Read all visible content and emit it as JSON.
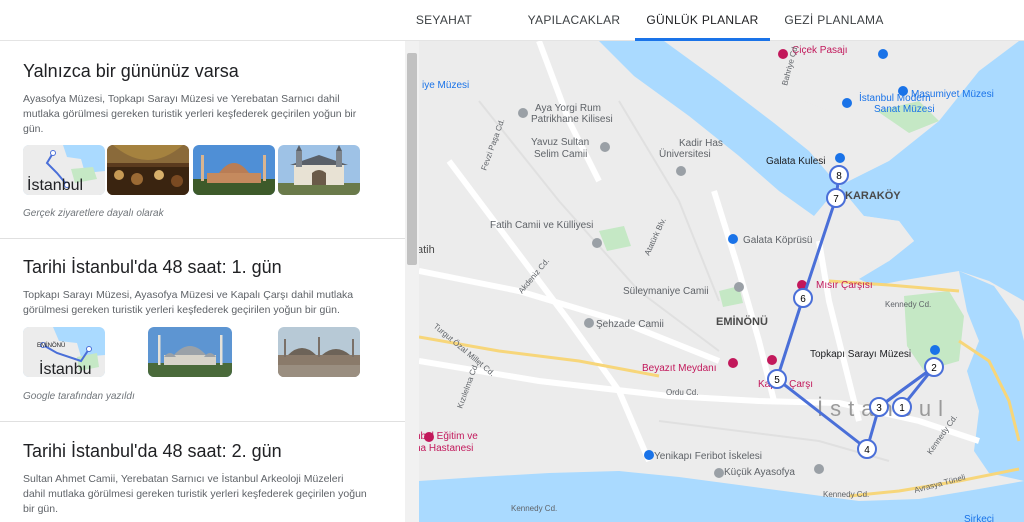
{
  "tabs": [
    {
      "label": "SEYAHAT REHBERİ"
    },
    {
      "label": "YAPILACAKLAR"
    },
    {
      "label": "GÜNLÜK PLANLAR",
      "active": true
    },
    {
      "label": "GEZİ PLANLAMA"
    }
  ],
  "plans": [
    {
      "title": "Yalnızca bir gününüz varsa",
      "description": "Ayasofya Müzesi, Topkapı Sarayı Müzesi ve Yerebatan Sarnıcı dahil mutlaka görülmesi gereken turistik yerleri keşfederek geçirilen yoğun bir gün.",
      "map_thumb_label": "İstanbul",
      "source": "Gerçek ziyaretlere dayalı olarak"
    },
    {
      "title": "Tarihi İstanbul'da 48 saat: 1. gün",
      "description": "Topkapı Sarayı Müzesi, Ayasofya Müzesi ve Kapalı Çarşı dahil mutlaka görülmesi gereken turistik yerleri keşfederek geçirilen yoğun bir gün.",
      "map_thumb_label": "İstanbu",
      "map_thumb_sublabel": "EMİNÖNÜ",
      "source": "Google tarafından yazıldı"
    },
    {
      "title": "Tarihi İstanbul'da 48 saat: 2. gün",
      "description": "Sultan Ahmet Camii, Yerebatan Sarnıcı ve İstanbul Arkeoloji Müzeleri dahil mutlaka görülmesi gereken turistik yerleri keşfederek geçirilen yoğun bir gün."
    }
  ],
  "map": {
    "city_label": "İstanbul",
    "labels": {
      "cicek_pasaji": "Çiçek Pasajı",
      "masumiyet": "Masumiyet Müzesi",
      "istanbul_modern": "İstanbul Modern",
      "sanat_muzesi": "Sanat Müzesi",
      "aya_yorgi": "Aya Yorgi Rum",
      "patrikhane": "Patrikhane Kilisesi",
      "kadir_has": "Kadir Has",
      "universitesi": "Üniversitesi",
      "yavuz_sultan": "Yavuz Sultan",
      "selim_camii": "Selim Camii",
      "galata_kulesi": "Galata Kulesi",
      "karakoy": "KARAKÖY",
      "fatih_camii": "Fatih Camii ve Külliyesi",
      "galata_koprusu": "Galata Köprüsü",
      "fatih": "atih",
      "misir_carsisi": "Mısır Çarşısı",
      "suleymaniye": "Süleymaniye Camii",
      "sehzade": "Şehzade Camii",
      "eminonu": "EMİNÖNÜ",
      "kennedy": "Kennedy Cd.",
      "topkapi": "Topkapı Sarayı Müzesi",
      "beyazit": "Beyazıt Meydanı",
      "kapali_carsi": "Kapalı Çarşı",
      "ordu_cd": "Ordu Cd.",
      "aksaray": "Akdeniz Cd.",
      "turgut_ozal": "Turgut Özal Millet Cd.",
      "kiziltoprak": "Kızılelma Cd.",
      "ataturk_blv": "Atatürk Blv.",
      "fevzi_pasa": "Fevzi Paşa Cd.",
      "egitim": "nbul Eğitim ve",
      "hastanesi": "na Hastanesi",
      "yenikapi": "Yenikapı Feribot İskelesi",
      "kucuk_ayasofya": "Küçük Ayasofya",
      "avrasya": "Avrasya Tüneli",
      "kennedy2": "Kennedy Cd.",
      "kennedy3": "Kennedy Cd.",
      "sirkeci": "Sirkeci",
      "iye_muzesi": "iye Müzesi",
      "beyoglu": "Bahriye Cd."
    },
    "route_stops": [
      "1",
      "2",
      "3",
      "4",
      "5",
      "6",
      "7",
      "8"
    ]
  },
  "colors": {
    "accent": "#1a73e8",
    "route": "#4a6fd8",
    "water": "#aadaff",
    "park": "#c5e8c5"
  }
}
